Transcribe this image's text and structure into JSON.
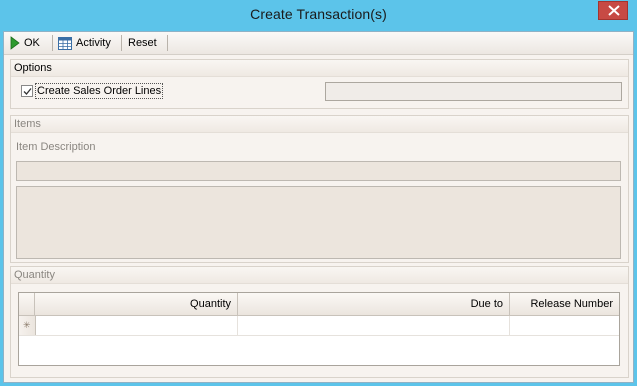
{
  "window": {
    "title": "Create Transaction(s)"
  },
  "toolbar": {
    "ok_label": "OK",
    "activity_label": "Activity",
    "reset_label": "Reset"
  },
  "options": {
    "header": "Options",
    "create_sales_order_lines_label": "Create Sales Order Lines",
    "create_sales_order_lines_checked": true,
    "right_field_value": ""
  },
  "items": {
    "header": "Items",
    "item_description_label": "Item Description",
    "item_description_value": "",
    "item_notes_value": ""
  },
  "quantity": {
    "header": "Quantity",
    "columns": [
      "Quantity",
      "Due to",
      "Release Number"
    ],
    "new_row_marker": "✳"
  },
  "colors": {
    "titlebar": "#5cc4ea",
    "window_bg": "#f7f3ef",
    "close_button": "#c74a44",
    "disabled_field": "#ece5dd"
  }
}
